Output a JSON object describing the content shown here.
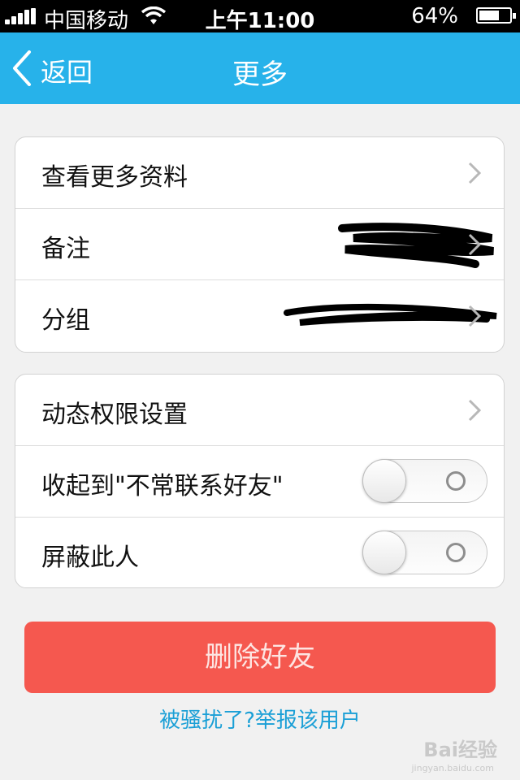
{
  "status_bar": {
    "carrier": "中国移动",
    "time": "上午11:00",
    "battery": "64%",
    "battery_level": 0.64
  },
  "nav": {
    "back_label": "返回",
    "title": "更多"
  },
  "group1": {
    "rows": [
      {
        "label": "查看更多资料"
      },
      {
        "label": "备注"
      },
      {
        "label": "分组"
      }
    ]
  },
  "group2": {
    "rows": [
      {
        "label": "动态权限设置"
      },
      {
        "label": "收起到\"不常联系好友\"",
        "toggle": false
      },
      {
        "label": "屏蔽此人",
        "toggle": false
      }
    ]
  },
  "actions": {
    "delete_label": "删除好友",
    "report_link": "被骚扰了?举报该用户"
  },
  "watermark": {
    "text": "Bai经验",
    "sub": "jingyan.baidu.com"
  },
  "colors": {
    "nav_bg": "#27b2ea",
    "delete_bg": "#f5584f",
    "link": "#1a9fd6"
  },
  "icons": [
    "signal-icon",
    "wifi-icon",
    "battery-icon",
    "back-chevron-icon",
    "chevron-right-icon"
  ]
}
